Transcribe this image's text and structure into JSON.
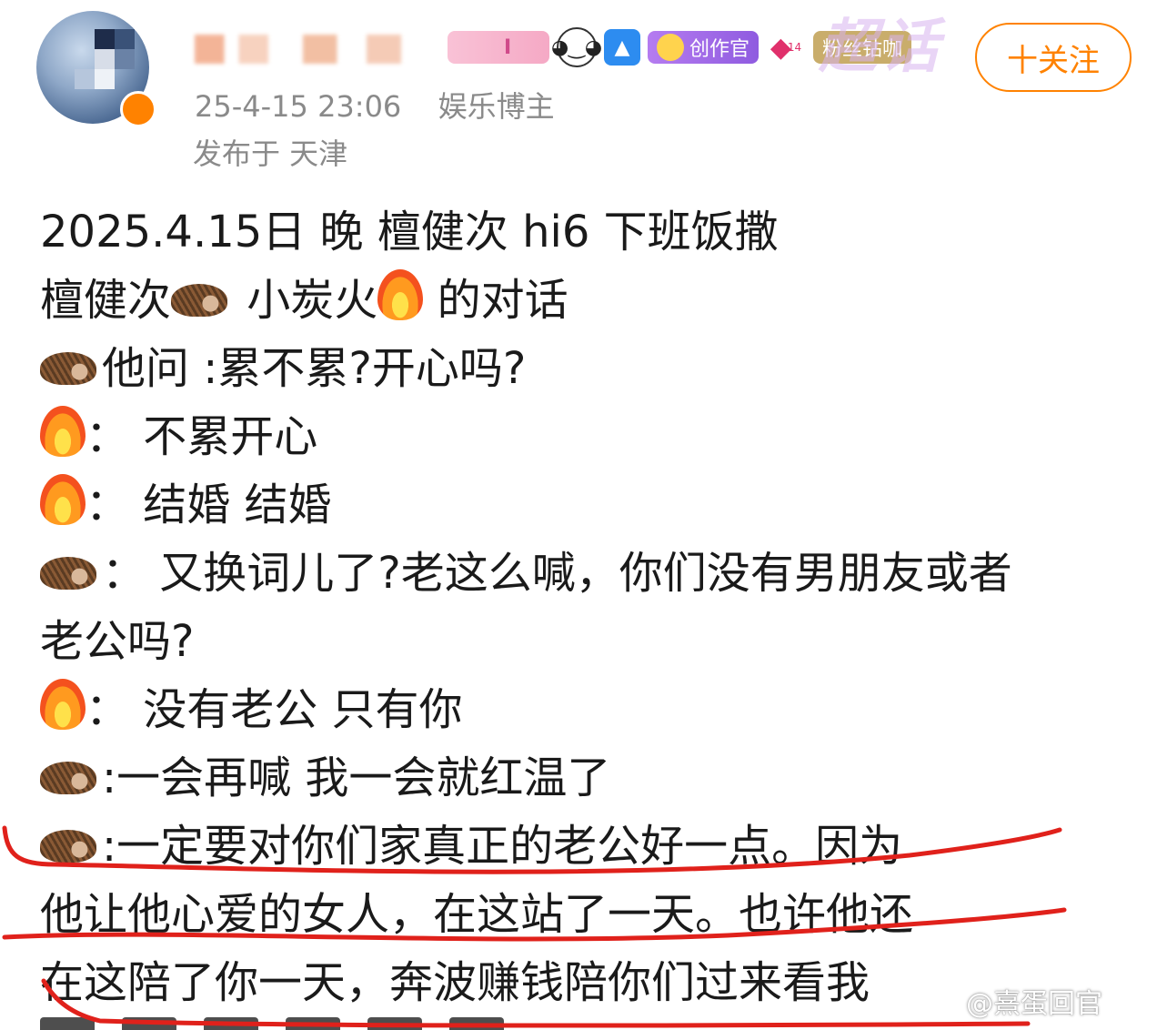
{
  "header": {
    "follow_label": "十关注",
    "time": "25-4-15 23:06",
    "author_tag": "娱乐博主",
    "location": "发布于 天津",
    "badges": {
      "creator": "创作官",
      "fans": "粉丝钻咖",
      "gem_level": "14",
      "pink_letter": "I"
    },
    "supertopic_label": "超话"
  },
  "post": {
    "lines": [
      "2025.4.15日 晚 檀健次 hi6 下班饭撒",
      "檀健次",
      "小炭火",
      "的对话",
      "他问 :累不累?开心吗?",
      "：  不累开心",
      "：  结婚 结婚",
      "：  又换词儿了?老这么喊，你们没有男朋友或者",
      "老公吗?",
      "：  没有老公 只有你",
      ":一会再喊 我一会就红温了",
      ":一定要对你们家真正的老公好一点。因为",
      "他让他心爱的女人，在这站了一天。也许他还",
      "在这陪了你一天，奔波赚钱陪你们过来看我"
    ]
  },
  "watermark": "@熹蛋回官",
  "colors": {
    "accent": "#ff8200",
    "annotation": "#e0211b",
    "meta": "#8a8a8a"
  }
}
